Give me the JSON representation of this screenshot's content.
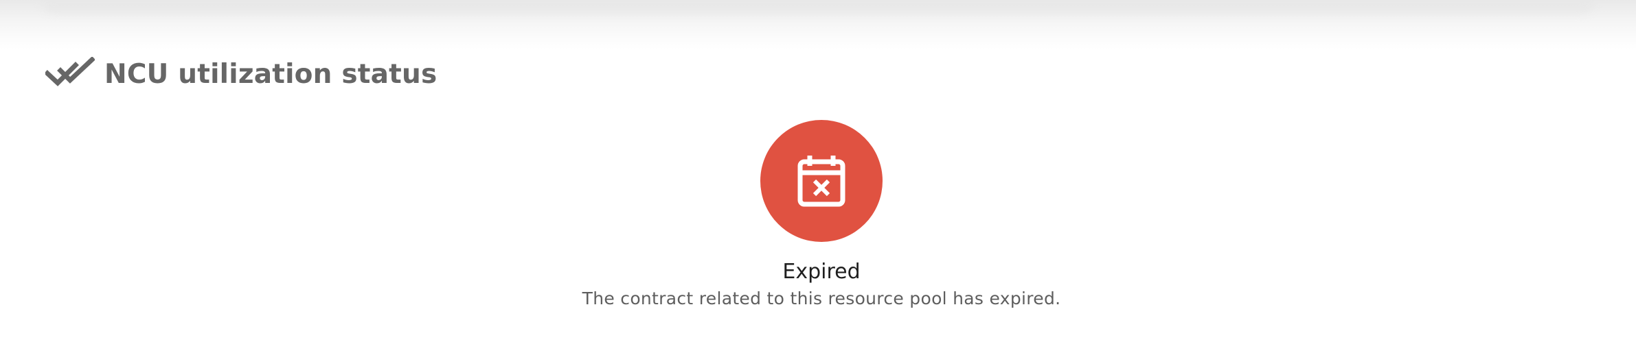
{
  "section": {
    "title": "NCU utilization status",
    "icon": "double-check-icon"
  },
  "status": {
    "icon": "calendar-x-icon",
    "color": "#e05241",
    "label": "Expired",
    "description": "The contract related to this resource pool has expired."
  }
}
